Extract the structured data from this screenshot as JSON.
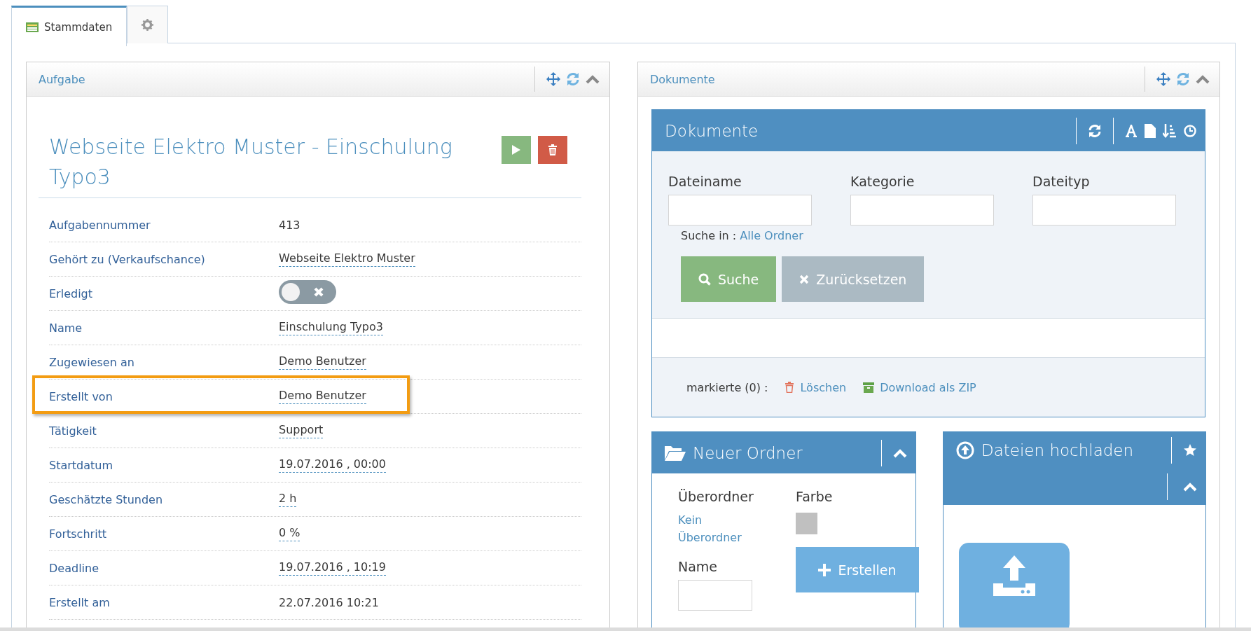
{
  "tabs": [
    {
      "kind": "data",
      "label": "Stammdaten",
      "selected": true
    },
    {
      "kind": "settings",
      "selected": false
    }
  ],
  "task_widget": {
    "header": "Aufgabe",
    "title": "Webseite Elektro Muster - Einschulung Typo3",
    "rows": [
      {
        "label": "Aufgabennummer",
        "kind": "text",
        "value": "413",
        "highlighted": false
      },
      {
        "label": "Gehört zu (Verkaufschance)",
        "kind": "editable",
        "value": "Webseite Elektro Muster",
        "highlighted": false
      },
      {
        "label": "Erledigt",
        "kind": "toggle",
        "on": false,
        "highlighted": false
      },
      {
        "label": "Name",
        "kind": "editable",
        "value": "Einschulung Typo3",
        "highlighted": false
      },
      {
        "label": "Zugewiesen an",
        "kind": "editable",
        "value": "Demo Benutzer",
        "highlighted": false
      },
      {
        "label": "Erstellt von",
        "kind": "editable",
        "value": "Demo Benutzer",
        "highlighted": true
      },
      {
        "label": "Tätigkeit",
        "kind": "editable",
        "value": "Support",
        "highlighted": false
      },
      {
        "label": "Startdatum",
        "kind": "editable",
        "value": "19.07.2016 ,  00:00",
        "highlighted": false
      },
      {
        "label": "Geschätzte Stunden",
        "kind": "editable",
        "value": "2 h",
        "highlighted": false
      },
      {
        "label": "Fortschritt",
        "kind": "editable",
        "value": "0 %",
        "highlighted": false
      },
      {
        "label": "Deadline",
        "kind": "editable",
        "value": "19.07.2016 ,  10:19",
        "highlighted": false
      },
      {
        "label": "Erstellt am",
        "kind": "text",
        "value": "22.07.2016 10:21",
        "highlighted": false
      }
    ]
  },
  "documents_widget": {
    "header": "Dokumente",
    "panel_title": "Dokumente",
    "filters": [
      {
        "label": "Dateiname"
      },
      {
        "label": "Kategorie"
      },
      {
        "label": "Dateityp"
      }
    ],
    "search_in_label": "Suche in :",
    "search_in_link": "Alle Ordner",
    "search_button": "Suche",
    "reset_button": "Zurücksetzen",
    "marked_label": "markierte (0) :",
    "delete_link": "Löschen",
    "download_link": "Download als ZIP",
    "new_folder": {
      "title": "Neuer Ordner",
      "parent_label": "Überordner",
      "parent_link": "Kein Überordner",
      "color_label": "Farbe",
      "color": "#c0c0c0",
      "create_button": "Erstellen",
      "name_label": "Name"
    },
    "upload": {
      "title": "Dateien hochladen"
    }
  }
}
